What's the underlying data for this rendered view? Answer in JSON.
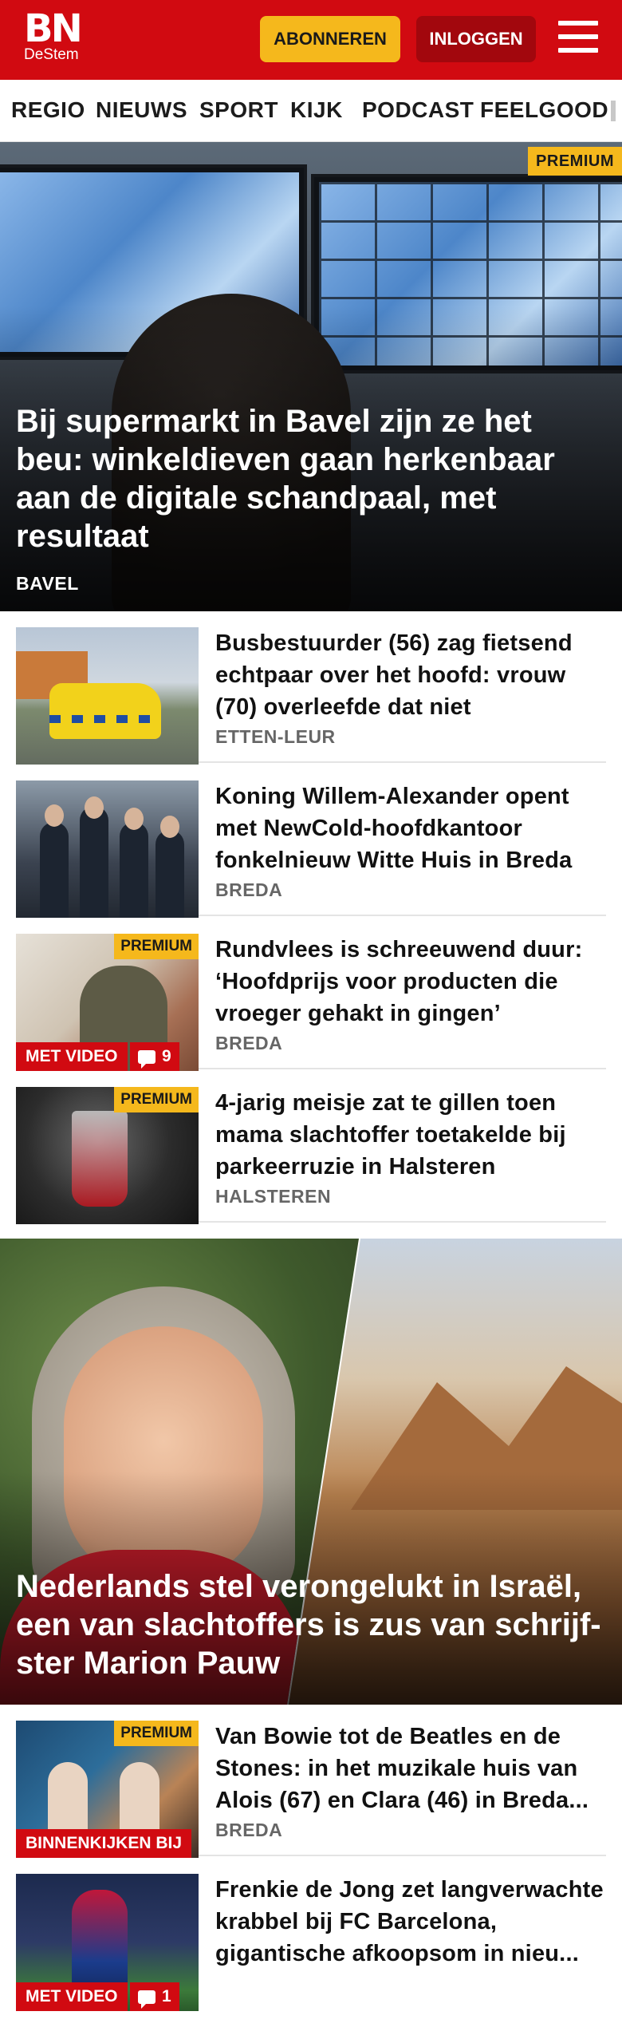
{
  "header": {
    "logo_main": "BN",
    "logo_sub": "DeStem",
    "subscribe_label": "ABONNEREN",
    "login_label": "INLOGGEN",
    "brand_red": "#d10a11",
    "accent_yellow": "#f5b81c"
  },
  "nav": {
    "items": [
      "REGIO",
      "NIEUWS",
      "SPORT",
      "KIJK",
      "PODCAST",
      "FEELGOOD"
    ]
  },
  "hero": {
    "badge": "PREMIUM",
    "title": "Bij supermarkt in Bavel zijn ze het beu: winkeldieven gaan herkenbaar aan de digitale schandpaal, met resultaat",
    "location": "BAVEL"
  },
  "articles": [
    {
      "title": "Busbestuurder (56) zag fietsend echtpaar over het hoofd: vrouw (70) overleefde dat niet",
      "location": "ETTEN-LEUR"
    },
    {
      "title": "Koning Willem-Alexander opent met NewCold-hoofdkantoor fonkelnieuw Witte Huis in Breda",
      "location": "BREDA"
    },
    {
      "title": "Rundvlees is schreeuwend duur: ‘Hoofdprijs voor producten die vroeger gehakt in gingen’",
      "location": "BREDA",
      "badge": "PREMIUM",
      "tag": "MET VIDEO",
      "comments": "9"
    },
    {
      "title": "4-jarig meisje zat te gillen toen mama slachtoffer toetakelde bij parkeerruzie in Halsteren",
      "location": "HALSTEREN",
      "badge": "PREMIUM"
    }
  ],
  "feature": {
    "title": "Nederlands stel verongelukt in Israël, een van slachtoffers is zus van schrijf­ster Marion Pauw"
  },
  "articles2": [
    {
      "title": "Van Bowie tot de Beatles en de Stones: in het muzikale huis van Alois (67) en Clara (46) in Breda...",
      "location": "BREDA",
      "badge": "PREMIUM",
      "tag": "BINNENKIJKEN BIJ"
    },
    {
      "title": "Frenkie de Jong zet langver­wachte krabbel bij FC Barcelona, gigantische afkoopsom in nieu...",
      "tag": "MET VIDEO",
      "comments": "1"
    }
  ]
}
